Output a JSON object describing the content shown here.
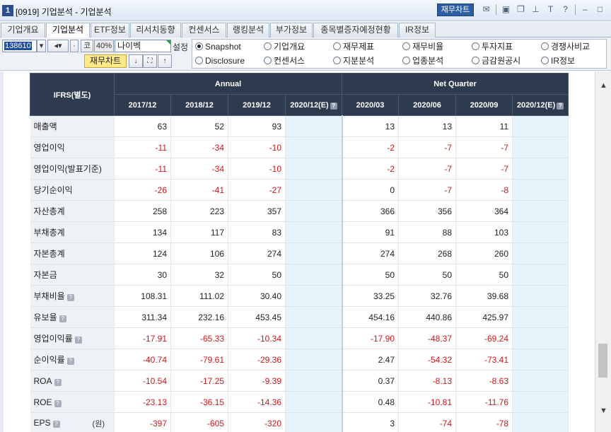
{
  "window": {
    "number": "1",
    "title": "[0919] 기업분석 - 기업분석",
    "jaemu_chart_label": "재무차트"
  },
  "tabs": [
    {
      "label": "기업개요",
      "active": false
    },
    {
      "label": "기업분석",
      "active": true
    },
    {
      "label": "ETF정보",
      "active": false
    },
    {
      "label": "리서치동향",
      "active": false
    },
    {
      "label": "컨센서스",
      "active": false
    },
    {
      "label": "랭킹분석",
      "active": false
    },
    {
      "label": "부가정보",
      "active": false
    },
    {
      "label": "종목별증자예정현황",
      "active": false
    },
    {
      "label": "IR정보",
      "active": false
    }
  ],
  "controls": {
    "code": "138610",
    "market": "코",
    "percent": "40%",
    "name": "나이벡",
    "setting_label": "설정",
    "jaemu_chart_label": "재무차트"
  },
  "radios": [
    {
      "label": "Snapshot",
      "checked": true
    },
    {
      "label": "기업개요",
      "checked": false
    },
    {
      "label": "재무제표",
      "checked": false
    },
    {
      "label": "재무비율",
      "checked": false
    },
    {
      "label": "투자지표",
      "checked": false
    },
    {
      "label": "경쟁사비교",
      "checked": false
    },
    {
      "label": "Disclosure",
      "checked": false
    },
    {
      "label": "컨센서스",
      "checked": false
    },
    {
      "label": "지분분석",
      "checked": false
    },
    {
      "label": "업종분석",
      "checked": false
    },
    {
      "label": "금감원공시",
      "checked": false
    },
    {
      "label": "IR정보",
      "checked": false
    }
  ],
  "table": {
    "corner": "IFRS(별도)",
    "group_annual": "Annual",
    "group_quarter": "Net Quarter",
    "columns": [
      "2017/12",
      "2018/12",
      "2019/12",
      "2020/12(E)",
      "2020/03",
      "2020/06",
      "2020/09",
      "2020/12(E)"
    ],
    "rows": [
      {
        "label": "매출액",
        "help": false,
        "unit": "",
        "values": [
          "63",
          "52",
          "93",
          "",
          "13",
          "13",
          "11",
          ""
        ]
      },
      {
        "label": "영업이익",
        "help": false,
        "unit": "",
        "values": [
          "-11",
          "-34",
          "-10",
          "",
          "-2",
          "-7",
          "-7",
          ""
        ]
      },
      {
        "label": "영업이익(발표기준)",
        "help": false,
        "unit": "",
        "values": [
          "-11",
          "-34",
          "-10",
          "",
          "-2",
          "-7",
          "-7",
          ""
        ]
      },
      {
        "label": "당기순이익",
        "help": false,
        "unit": "",
        "values": [
          "-26",
          "-41",
          "-27",
          "",
          "0",
          "-7",
          "-8",
          ""
        ]
      },
      {
        "label": "자산총계",
        "help": false,
        "unit": "",
        "values": [
          "258",
          "223",
          "357",
          "",
          "366",
          "356",
          "364",
          ""
        ]
      },
      {
        "label": "부채총계",
        "help": false,
        "unit": "",
        "values": [
          "134",
          "117",
          "83",
          "",
          "91",
          "88",
          "103",
          ""
        ]
      },
      {
        "label": "자본총계",
        "help": false,
        "unit": "",
        "values": [
          "124",
          "106",
          "274",
          "",
          "274",
          "268",
          "260",
          ""
        ]
      },
      {
        "label": "자본금",
        "help": false,
        "unit": "",
        "values": [
          "30",
          "32",
          "50",
          "",
          "50",
          "50",
          "50",
          ""
        ]
      },
      {
        "label": "부채비율",
        "help": true,
        "unit": "",
        "values": [
          "108.31",
          "111.02",
          "30.40",
          "",
          "33.25",
          "32.76",
          "39.68",
          ""
        ]
      },
      {
        "label": "유보율",
        "help": true,
        "unit": "",
        "values": [
          "311.34",
          "232.16",
          "453.45",
          "",
          "454.16",
          "440.86",
          "425.97",
          ""
        ]
      },
      {
        "label": "영업이익률",
        "help": true,
        "unit": "",
        "values": [
          "-17.91",
          "-65.33",
          "-10.34",
          "",
          "-17.90",
          "-48.37",
          "-69.24",
          ""
        ]
      },
      {
        "label": "순이익률",
        "help": true,
        "unit": "",
        "values": [
          "-40.74",
          "-79.61",
          "-29.36",
          "",
          "2.47",
          "-54.32",
          "-73.41",
          ""
        ]
      },
      {
        "label": "ROA",
        "help": true,
        "unit": "",
        "values": [
          "-10.54",
          "-17.25",
          "-9.39",
          "",
          "0.37",
          "-8.13",
          "-8.63",
          ""
        ]
      },
      {
        "label": "ROE",
        "help": true,
        "unit": "",
        "values": [
          "-23.13",
          "-36.15",
          "-14.36",
          "",
          "0.48",
          "-10.81",
          "-11.76",
          ""
        ]
      },
      {
        "label": "EPS",
        "help": true,
        "unit": "(원)",
        "values": [
          "-397",
          "-605",
          "-320",
          "",
          "3",
          "-74",
          "-78",
          ""
        ]
      }
    ]
  }
}
